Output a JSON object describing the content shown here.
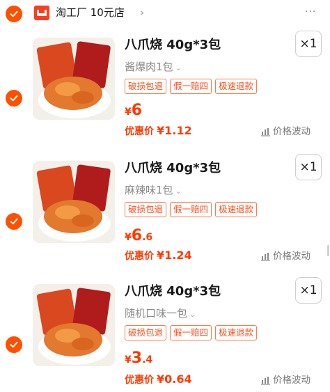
{
  "store": {
    "name": "淘工厂 10元店",
    "chevron": "›",
    "more": "···"
  },
  "items": [
    {
      "title": "八爪烧 40g*3包",
      "variant": "酱爆肉1包",
      "qty": "×1",
      "tags": [
        "破损包退",
        "假一赔四",
        "极速退款"
      ],
      "price_currency": "¥",
      "price_int": "6",
      "price_dec": "",
      "promo_label": "优惠价",
      "promo_amount": "¥1.12",
      "trend_label": "价格波动"
    },
    {
      "title": "八爪烧 40g*3包",
      "variant": "麻辣味1包",
      "qty": "×1",
      "tags": [
        "破损包退",
        "假一赔四",
        "极速退款"
      ],
      "price_currency": "¥",
      "price_int": "6",
      "price_dec": ".6",
      "promo_label": "优惠价",
      "promo_amount": "¥1.24",
      "trend_label": "价格波动"
    },
    {
      "title": "八爪烧 40g*3包",
      "variant": "随机口味一包",
      "qty": "×1",
      "tags": [
        "破损包退",
        "假一赔四",
        "极速退款"
      ],
      "price_currency": "¥",
      "price_int": "3",
      "price_dec": ".4",
      "promo_label": "优惠价",
      "promo_amount": "¥0.64",
      "trend_label": "价格波动"
    }
  ],
  "colors": {
    "accent": "#ff5000",
    "price": "#ff3a00",
    "tag_border": "#ff7a4a"
  },
  "icons": [
    "check-icon",
    "store-logo-icon",
    "chevron-right-icon",
    "more-icon",
    "caret-down-icon",
    "trend-chart-icon"
  ]
}
